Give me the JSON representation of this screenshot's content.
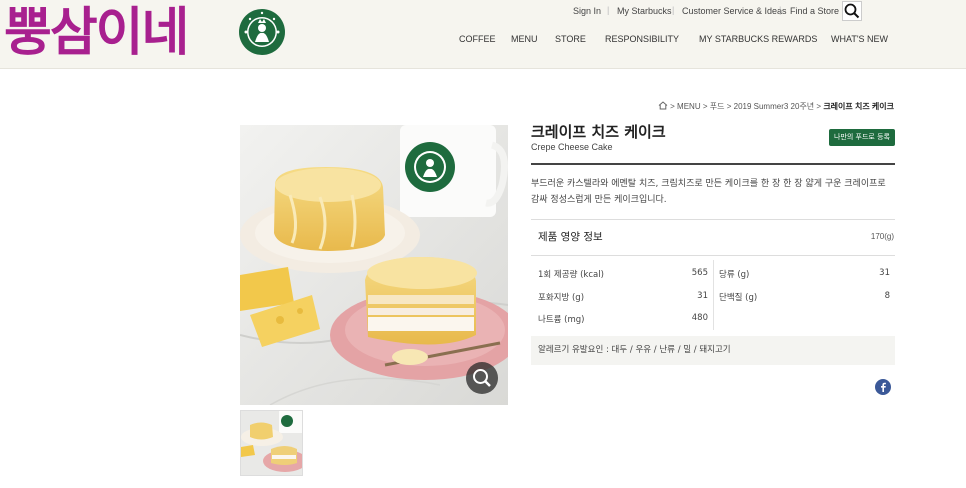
{
  "site": {
    "wordmark": "뿡삼이네"
  },
  "utility_nav": [
    "Sign In",
    "My Starbucks",
    "Customer Service & Ideas",
    "Find a Store"
  ],
  "main_nav": [
    "COFFEE",
    "MENU",
    "STORE",
    "RESPONSIBILITY",
    "MY STARBUCKS REWARDS",
    "WHAT'S NEW"
  ],
  "breadcrumb": [
    "MENU",
    "푸드",
    "2019 Summer3 20주년",
    "크레이프 치즈 케이크"
  ],
  "product": {
    "name_ko": "크레이프 치즈 케이크",
    "name_en": "Crepe Cheese Cake",
    "fav_button": "나만의 푸드로 등록",
    "description": "부드러운 카스텔라와 에멘탈 치즈, 크림치즈로 만든 케이크를 한 장 한 장 얇게 구운 크레이프로 감싸 정성스럽게 만든 케이크입니다."
  },
  "nutrition": {
    "title": "제품 영양 정보",
    "serving": "170(g)",
    "rows": [
      {
        "label": "1회 제공량 (kcal)",
        "value": "565"
      },
      {
        "label": "당류 (g)",
        "value": "31"
      },
      {
        "label": "포화지방 (g)",
        "value": "31"
      },
      {
        "label": "단백질 (g)",
        "value": "8"
      },
      {
        "label": "나트륨 (mg)",
        "value": "480"
      }
    ],
    "allergy": "알레르기 유발요인 : 대두 / 우유 / 난류 / 밀 / 돼지고기"
  },
  "colors": {
    "wordmark": "#a8208f",
    "starbucks_green": "#1e6b3e",
    "facebook": "#3b5998"
  },
  "icons": [
    "starbucks-siren-logo",
    "search-icon",
    "home-icon",
    "zoom-icon",
    "facebook-icon"
  ]
}
